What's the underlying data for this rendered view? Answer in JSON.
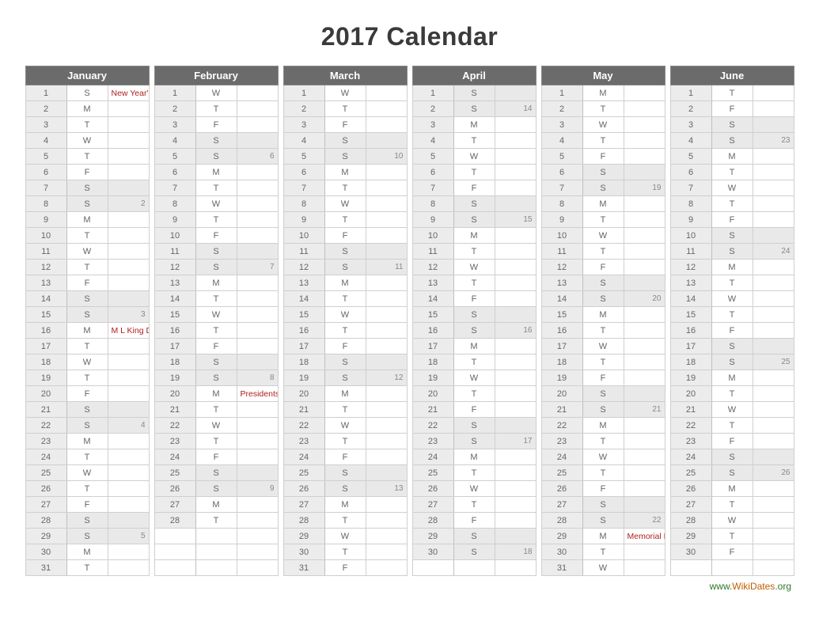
{
  "title": "2017 Calendar",
  "footer": {
    "prefix": "www.",
    "mid": "WikiDates",
    "suffix": ".org"
  },
  "dow": [
    "S",
    "M",
    "T",
    "W",
    "T",
    "F",
    "S"
  ],
  "months": [
    {
      "name": "January",
      "startDow": 0,
      "daysInMonth": 31,
      "events": {
        "1": "New Year's Day",
        "16": "M L King Day"
      },
      "weekMarks": {
        "8": "2",
        "15": "3",
        "22": "4",
        "29": "5"
      }
    },
    {
      "name": "February",
      "startDow": 3,
      "daysInMonth": 28,
      "events": {
        "20": "Presidents Day"
      },
      "weekMarks": {
        "5": "6",
        "12": "7",
        "19": "8",
        "26": "9"
      }
    },
    {
      "name": "March",
      "startDow": 3,
      "daysInMonth": 31,
      "events": {},
      "weekMarks": {
        "5": "10",
        "12": "11",
        "19": "12",
        "26": "13"
      }
    },
    {
      "name": "April",
      "startDow": 6,
      "daysInMonth": 30,
      "events": {},
      "weekMarks": {
        "2": "14",
        "9": "15",
        "16": "16",
        "23": "17",
        "30": "18"
      }
    },
    {
      "name": "May",
      "startDow": 1,
      "daysInMonth": 31,
      "events": {
        "29": "Memorial Day"
      },
      "weekMarks": {
        "7": "19",
        "14": "20",
        "21": "21",
        "28": "22"
      }
    },
    {
      "name": "June",
      "startDow": 4,
      "daysInMonth": 30,
      "events": {},
      "weekMarks": {
        "4": "23",
        "11": "24",
        "18": "25",
        "25": "26"
      }
    }
  ]
}
